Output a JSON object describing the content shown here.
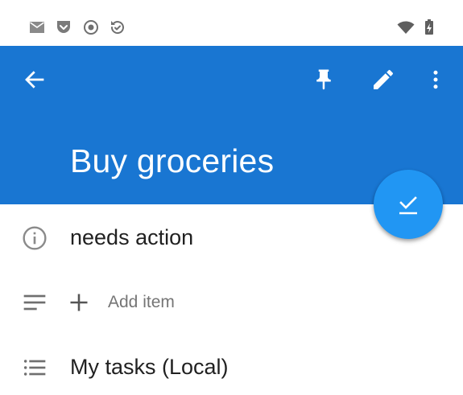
{
  "status_bar": {
    "left_icons": [
      "mail-icon",
      "pocket-icon",
      "record-icon",
      "sync-icon"
    ],
    "right_icons": [
      "wifi-icon",
      "battery-charging-icon"
    ]
  },
  "app_bar": {
    "color": "#1976d2",
    "back_icon": "arrow-back-icon",
    "actions": [
      "pin-icon",
      "edit-icon",
      "more-vert-icon"
    ],
    "title": "Buy groceries"
  },
  "fab": {
    "icon": "check-icon",
    "color": "#2196f3"
  },
  "details": {
    "status": {
      "icon": "info-icon",
      "text": "needs action"
    },
    "notes": {
      "icon": "notes-icon",
      "add_icon": "plus-icon",
      "add_label": "Add item"
    },
    "list": {
      "icon": "list-icon",
      "text": "My tasks (Local)"
    }
  }
}
